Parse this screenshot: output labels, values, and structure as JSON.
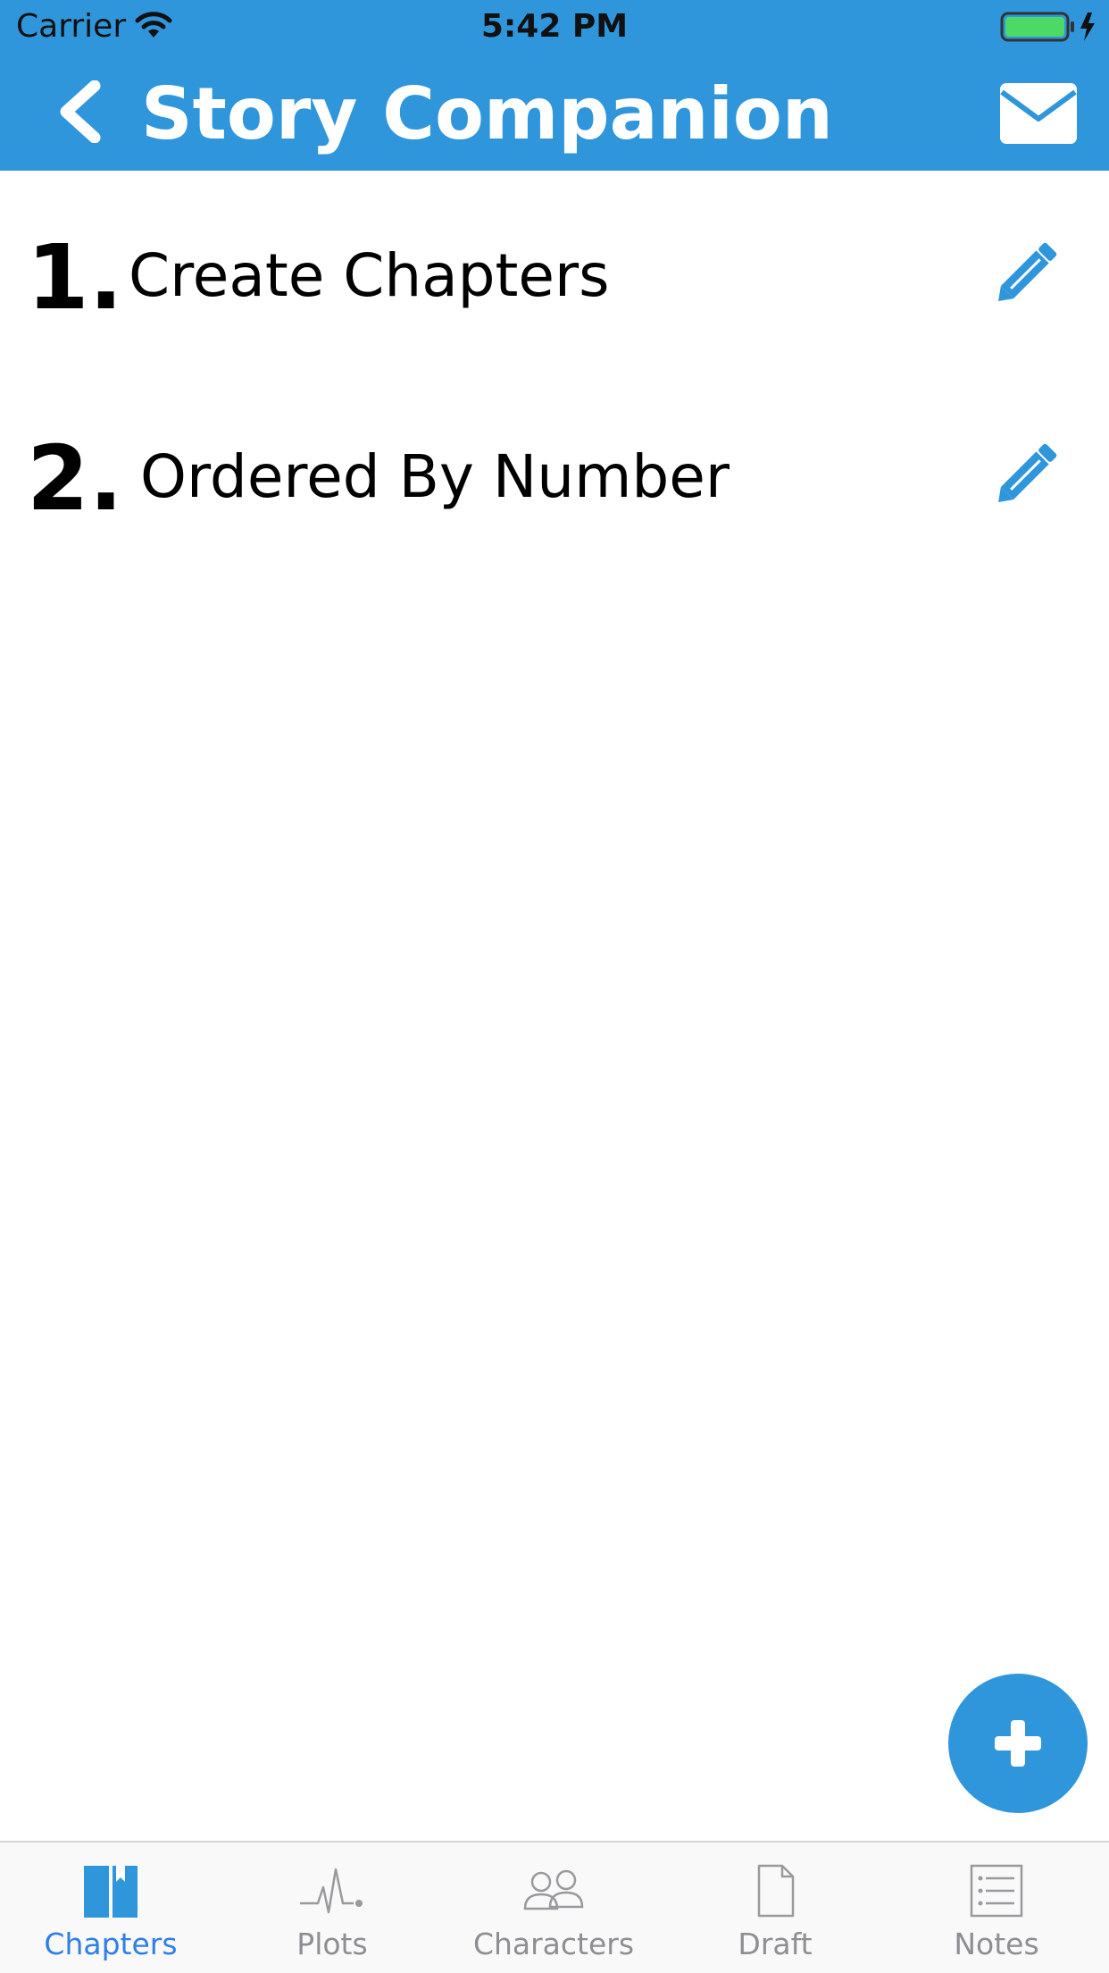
{
  "status_bar": {
    "carrier": "Carrier",
    "time": "5:42 PM",
    "wifi_icon": "wifi-icon",
    "battery_icon": "battery-charging-icon"
  },
  "nav": {
    "title": "Story Companion",
    "back_icon": "chevron-left-icon",
    "mail_icon": "envelope-icon"
  },
  "chapters": [
    {
      "number": "1.",
      "title": "Create Chapters",
      "edit_icon": "pencil-icon"
    },
    {
      "number": "2.",
      "title": "Ordered By Number",
      "edit_icon": "pencil-icon"
    }
  ],
  "fab": {
    "icon": "plus-icon"
  },
  "tabs": [
    {
      "label": "Chapters",
      "icon": "book-icon",
      "active": true
    },
    {
      "label": "Plots",
      "icon": "pulse-icon",
      "active": false
    },
    {
      "label": "Characters",
      "icon": "people-icon",
      "active": false
    },
    {
      "label": "Draft",
      "icon": "document-icon",
      "active": false
    },
    {
      "label": "Notes",
      "icon": "list-icon",
      "active": false
    }
  ],
  "colors": {
    "primary": "#3096DC",
    "tab_active": "#2F7FE4",
    "tab_inactive": "#8E8E93",
    "battery_fill": "#4CD964"
  }
}
